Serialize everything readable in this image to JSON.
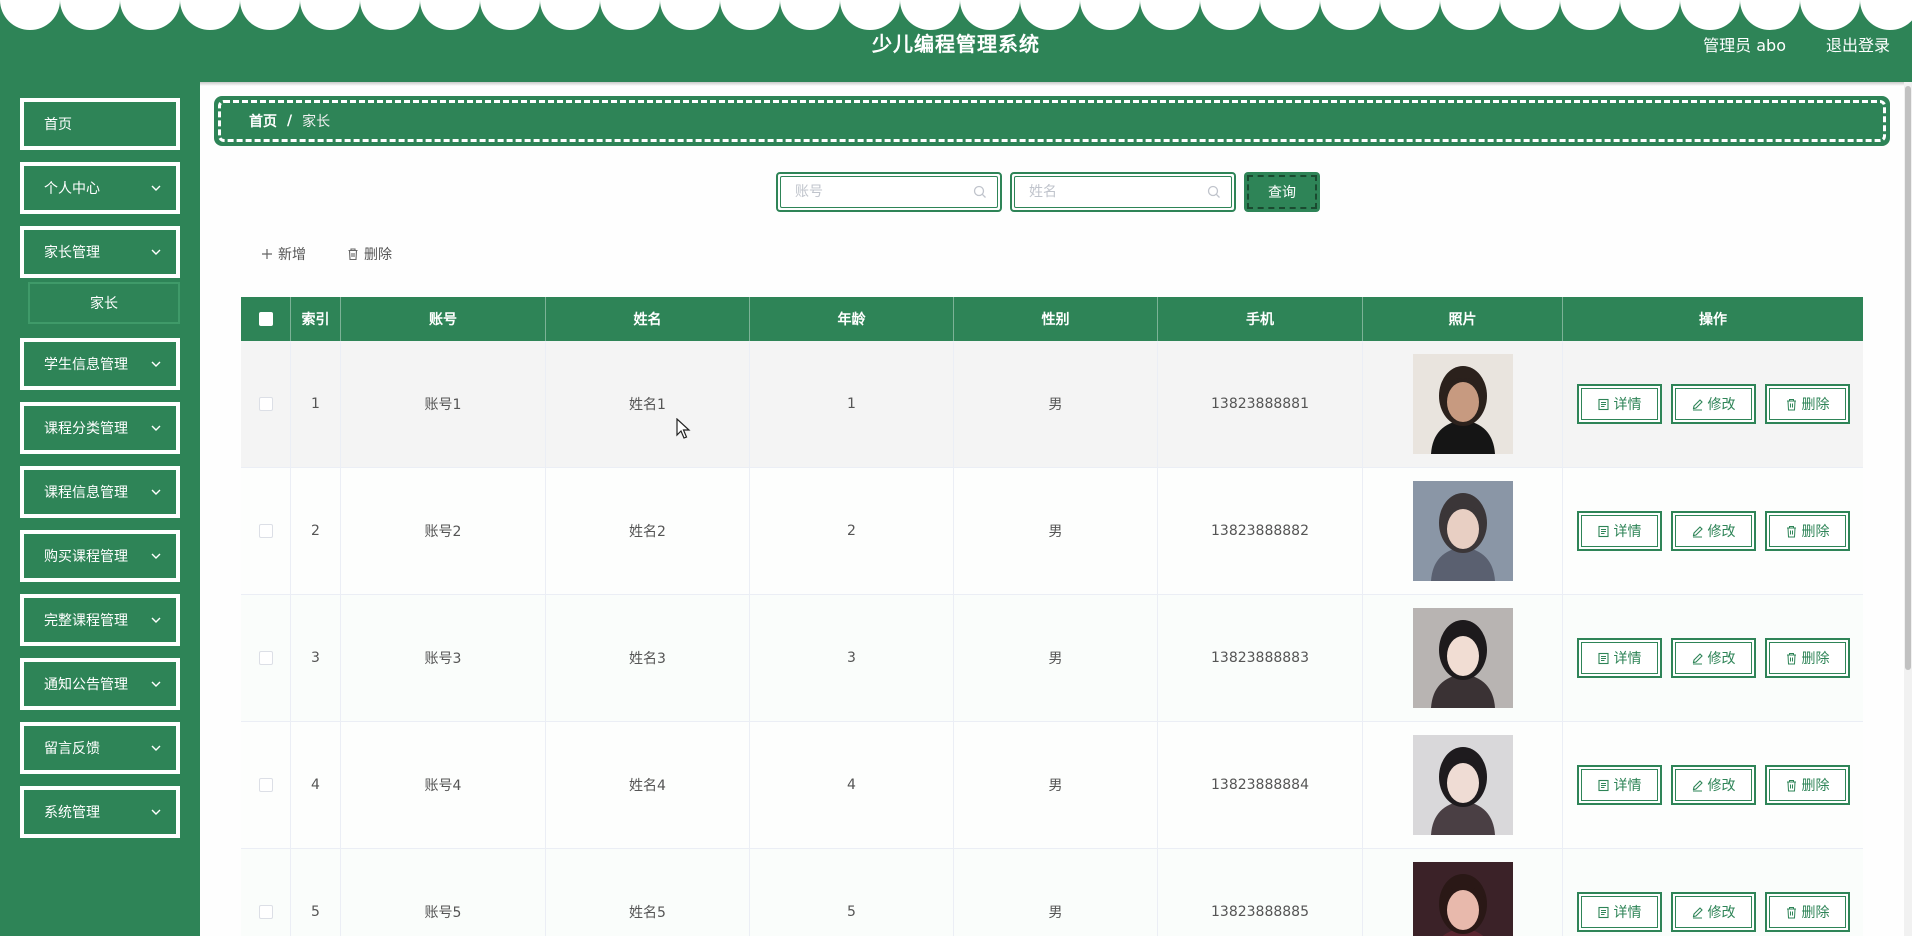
{
  "header": {
    "title": "少儿编程管理系统",
    "user_label": "管理员 abo",
    "logout_label": "退出登录"
  },
  "sidebar": {
    "items": [
      {
        "label": "首页",
        "has_arrow": false
      },
      {
        "label": "个人中心",
        "has_arrow": true
      },
      {
        "label": "家长管理",
        "has_arrow": true
      },
      {
        "label": "学生信息管理",
        "has_arrow": true
      },
      {
        "label": "课程分类管理",
        "has_arrow": true
      },
      {
        "label": "课程信息管理",
        "has_arrow": true
      },
      {
        "label": "购买课程管理",
        "has_arrow": true
      },
      {
        "label": "完整课程管理",
        "has_arrow": true
      },
      {
        "label": "通知公告管理",
        "has_arrow": true
      },
      {
        "label": "留言反馈",
        "has_arrow": true
      },
      {
        "label": "系统管理",
        "has_arrow": true
      }
    ],
    "submenu": {
      "label": "家长"
    }
  },
  "breadcrumb": {
    "home": "首页",
    "separator": "/",
    "current": "家长"
  },
  "search": {
    "account_placeholder": "账号",
    "name_placeholder": "姓名",
    "button_label": "查询"
  },
  "toolbar": {
    "add_label": "新增",
    "delete_label": "删除"
  },
  "table": {
    "columns": [
      "",
      "索引",
      "账号",
      "姓名",
      "年龄",
      "性别",
      "手机",
      "照片",
      "操作"
    ],
    "rows": [
      {
        "index": "1",
        "account": "账号1",
        "name": "姓名1",
        "age": "1",
        "gender": "男",
        "phone": "13823888881"
      },
      {
        "index": "2",
        "account": "账号2",
        "name": "姓名2",
        "age": "2",
        "gender": "男",
        "phone": "13823888882"
      },
      {
        "index": "3",
        "account": "账号3",
        "name": "姓名3",
        "age": "3",
        "gender": "男",
        "phone": "13823888883"
      },
      {
        "index": "4",
        "account": "账号4",
        "name": "姓名4",
        "age": "4",
        "gender": "男",
        "phone": "13823888884"
      },
      {
        "index": "5",
        "account": "账号5",
        "name": "姓名5",
        "age": "5",
        "gender": "男",
        "phone": "13823888885"
      }
    ],
    "actions": {
      "detail": "详情",
      "edit": "修改",
      "delete": "删除"
    }
  },
  "colors": {
    "primary": "#2e8457",
    "white": "#ffffff",
    "text": "#555555"
  }
}
